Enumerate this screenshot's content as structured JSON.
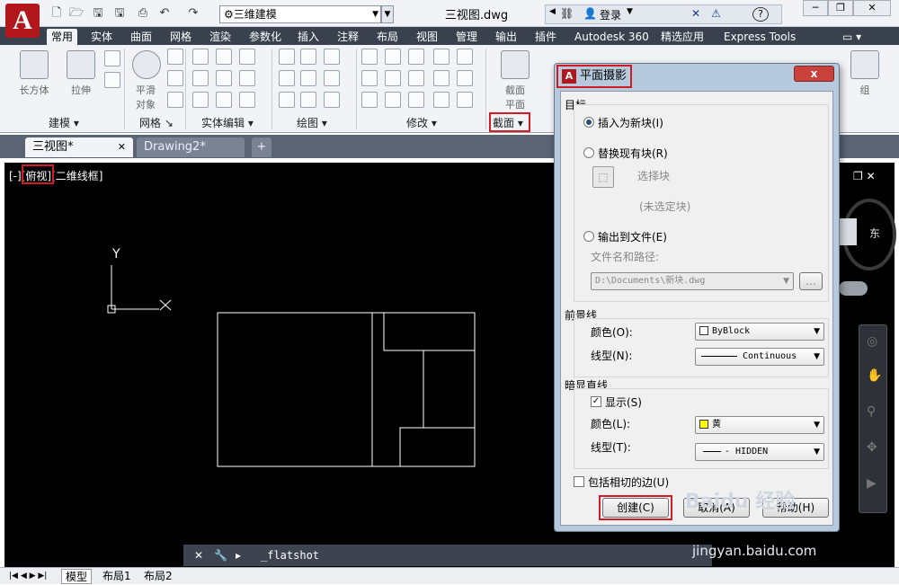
{
  "app": {
    "logo_letter": "A",
    "title": "三维建模",
    "document": "三视图.dwg"
  },
  "infocenter": {
    "login": "登录",
    "help": "?"
  },
  "ribbon_tabs": [
    "常用",
    "实体",
    "曲面",
    "网格",
    "渲染",
    "参数化",
    "插入",
    "注释",
    "布局",
    "视图",
    "管理",
    "输出",
    "插件",
    "Autodesk 360",
    "精选应用",
    "Express Tools"
  ],
  "active_tab": "常用",
  "panels": {
    "modeling": "建模 ▾",
    "mesh": "网格 ↘",
    "solid_edit": "实体编辑 ▾",
    "draw": "绘图 ▾",
    "modify": "修改 ▾",
    "section": "截面 ▾",
    "group": "组"
  },
  "big_buttons": {
    "box": "长方体",
    "extrude": "拉伸",
    "smooth_1": "平滑",
    "smooth_2": "对象",
    "section_plane_1": "截面",
    "section_plane_2": "平面"
  },
  "doc_tabs": [
    "三视图*",
    "Drawing2*"
  ],
  "viewport": {
    "minus": "[-]",
    "view": "[俯视]",
    "style": "[二维线框]"
  },
  "ucs": {
    "x": "X",
    "y": "Y"
  },
  "viewcube": {
    "east": "东"
  },
  "command": {
    "text": "_flatshot"
  },
  "layout_tabs": [
    "模型",
    "布局1",
    "布局2"
  ],
  "dialog": {
    "title": "平面摄影",
    "close": "x",
    "target": {
      "title": "目标",
      "insert_new": "插入为新块(I)",
      "replace": "替换现有块(R)",
      "select_block": "选择块",
      "no_selection": "(未选定块)",
      "export": "输出到文件(E)",
      "filename_label": "文件名和路径:",
      "path": "D:\\Documents\\新块.dwg",
      "browse": "..."
    },
    "foreground": {
      "title": "前景线",
      "color_label": "颜色(O):",
      "color": "ByBlock",
      "linetype_label": "线型(N):",
      "linetype": "Continuous"
    },
    "obscured": {
      "title": "暗显直线",
      "show": "显示(S)",
      "color_label": "颜色(L):",
      "color": "黄",
      "linetype_label": "线型(T):",
      "linetype": "HIDDEN"
    },
    "tangential": "包括相切的边(U)",
    "create": "创建(C)",
    "cancel": "取消(A)",
    "help": "帮助(H)"
  },
  "watermark": {
    "brand": "Baidu 经验",
    "url": "jingyan.baidu.com"
  },
  "colors": {
    "highlight": "#d01c24",
    "canvas": "#000000",
    "ribbon": "#f1f3f7",
    "tab_bar": "#39414f",
    "yellow": "#ffff00"
  }
}
